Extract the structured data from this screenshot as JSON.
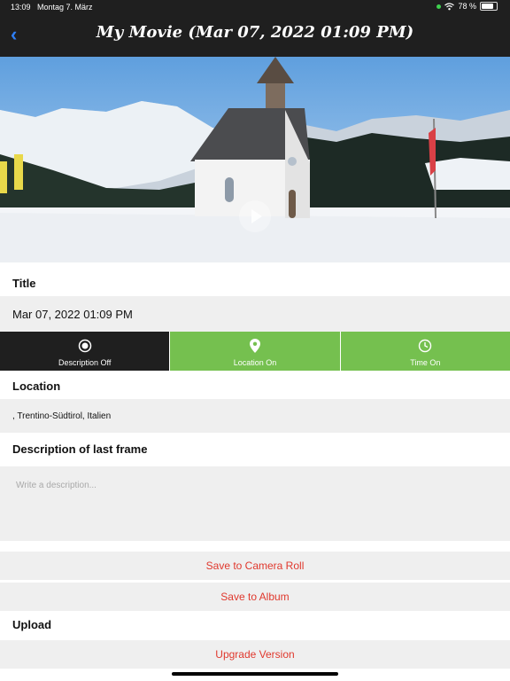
{
  "status": {
    "time": "13:09",
    "date": "Montag 7. März",
    "battery": "78 %"
  },
  "nav": {
    "title": "My Movie (Mar 07, 2022 01:09 PM)"
  },
  "title_section": {
    "label": "Title",
    "value": "Mar 07, 2022 01:09 PM"
  },
  "tabs": [
    {
      "label": "Description Off",
      "icon": "record-icon"
    },
    {
      "label": "Location On",
      "icon": "location-pin-icon"
    },
    {
      "label": "Time On",
      "icon": "clock-icon"
    }
  ],
  "location": {
    "label": "Location",
    "value": ", Trentino-Südtirol, Italien"
  },
  "description": {
    "label": "Description of last frame",
    "placeholder": "Write a description..."
  },
  "actions": {
    "save_camera_roll": "Save to Camera Roll",
    "save_album": "Save to Album",
    "upgrade": "Upgrade Version"
  },
  "upload": {
    "label": "Upload"
  },
  "colors": {
    "dark": "#1f1f1f",
    "green": "#75c04f",
    "action_red": "#e0382d",
    "field_gray": "#efefef"
  }
}
